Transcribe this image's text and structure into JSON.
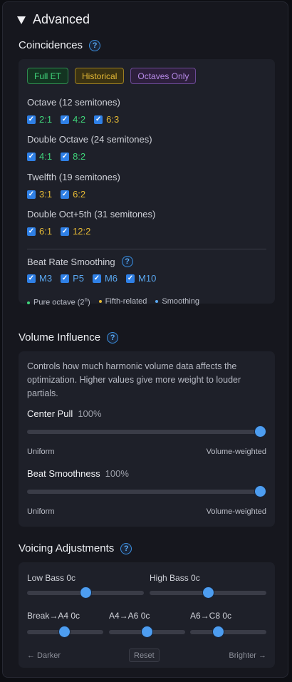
{
  "advanced": {
    "title": "Advanced"
  },
  "coincidences": {
    "title": "Coincidences",
    "help": "?",
    "presets": [
      "Full ET",
      "Historical",
      "Octaves Only"
    ],
    "groups": [
      {
        "label": "Octave (12 semitones)",
        "items": [
          {
            "label": "2:1",
            "color": "green",
            "checked": true
          },
          {
            "label": "4:2",
            "color": "green",
            "checked": true
          },
          {
            "label": "6:3",
            "color": "yellow",
            "checked": true
          }
        ]
      },
      {
        "label": "Double Octave (24 semitones)",
        "items": [
          {
            "label": "4:1",
            "color": "green",
            "checked": true
          },
          {
            "label": "8:2",
            "color": "green",
            "checked": true
          }
        ]
      },
      {
        "label": "Twelfth (19 semitones)",
        "items": [
          {
            "label": "3:1",
            "color": "yellow",
            "checked": true
          },
          {
            "label": "6:2",
            "color": "yellow",
            "checked": true
          }
        ]
      },
      {
        "label": "Double Oct+5th (31 semitones)",
        "items": [
          {
            "label": "6:1",
            "color": "yellow",
            "checked": true
          },
          {
            "label": "12:2",
            "color": "yellow",
            "checked": true
          }
        ]
      }
    ],
    "beat_rate": {
      "label": "Beat Rate Smoothing",
      "items": [
        {
          "label": "M3",
          "checked": true
        },
        {
          "label": "P5",
          "checked": true
        },
        {
          "label": "M6",
          "checked": true
        },
        {
          "label": "M10",
          "checked": true
        }
      ]
    },
    "legend": {
      "pure_octave": "Pure octave (2",
      "pure_octave_sup": "n",
      "pure_octave_end": ")",
      "fifth_related": "Fifth-related",
      "smoothing": "Smoothing"
    }
  },
  "volume": {
    "title": "Volume Influence",
    "help": "?",
    "description": "Controls how much harmonic volume data affects the optimization. Higher values give more weight to louder partials.",
    "sliders": [
      {
        "label": "Center Pull",
        "value_text": "100%",
        "value": 1.0,
        "left": "Uniform",
        "right": "Volume-weighted"
      },
      {
        "label": "Beat Smoothness",
        "value_text": "100%",
        "value": 1.0,
        "left": "Uniform",
        "right": "Volume-weighted"
      }
    ]
  },
  "voicing": {
    "title": "Voicing Adjustments",
    "help": "?",
    "low_bass": {
      "label": "Low Bass",
      "value": "0c",
      "position": 0.5
    },
    "high_bass": {
      "label": "High Bass",
      "value": "0c",
      "position": 0.5
    },
    "break_a4": {
      "label": "Break→A4",
      "value": "0c",
      "position": 0.5
    },
    "a4_a6": {
      "label": "A4→A6",
      "value": "0c",
      "position": 0.5
    },
    "a6_c8": {
      "label": "A6→C8",
      "value": "0c",
      "position": 0.5
    },
    "darker": "← Darker",
    "reset": "Reset",
    "brighter": "Brighter →"
  },
  "colors": {
    "green": "#3fd47a",
    "yellow": "#e5b935",
    "blue": "#5aa7f0",
    "accent": "#2f80e6"
  }
}
